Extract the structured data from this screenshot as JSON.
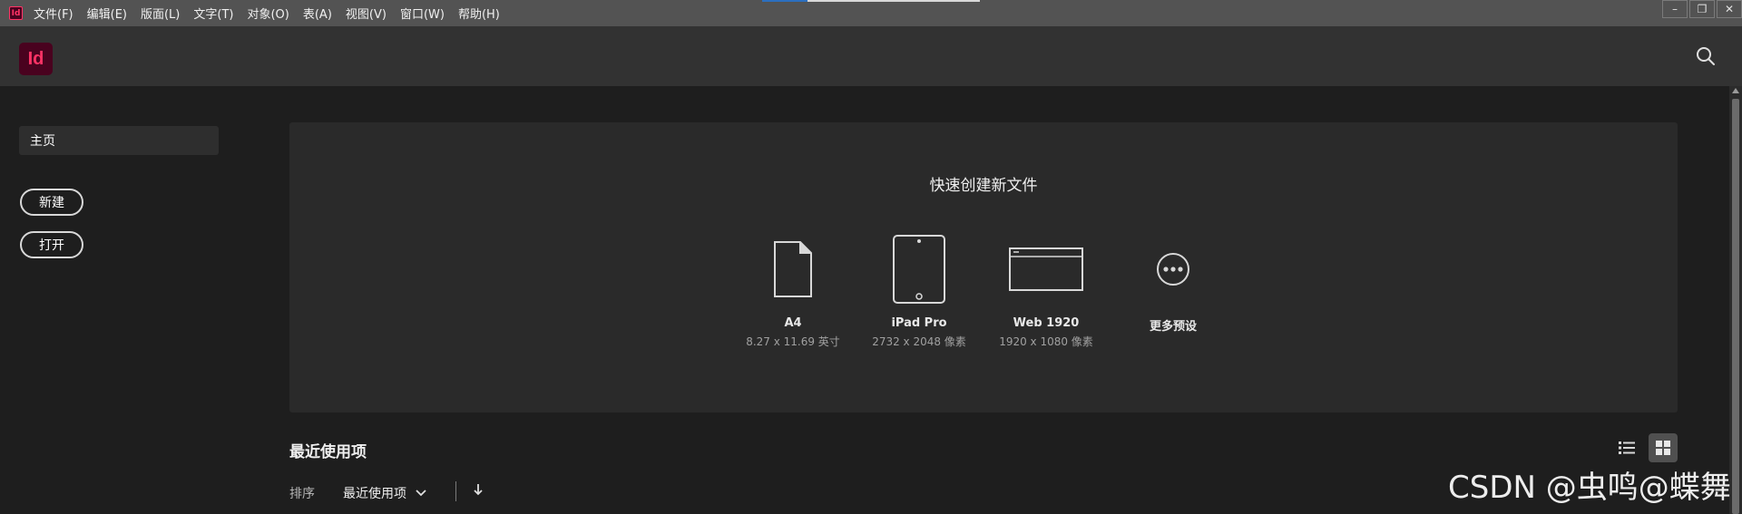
{
  "menubar": {
    "app_icon_text": "Id",
    "items": [
      "文件(F)",
      "编辑(E)",
      "版面(L)",
      "文字(T)",
      "对象(O)",
      "表(A)",
      "视图(V)",
      "窗口(W)",
      "帮助(H)"
    ],
    "window_controls": [
      "–",
      "❐",
      "✕"
    ]
  },
  "header": {
    "logo_text": "Id",
    "brand_color": "#ff3366",
    "search_icon": "search-icon"
  },
  "sidebar": {
    "home_label": "主页",
    "new_label": "新建",
    "open_label": "打开"
  },
  "quick_create": {
    "title": "快速创建新文件",
    "presets": [
      {
        "name": "A4",
        "dims": "8.27 x 11.69 英寸",
        "icon": "document-icon"
      },
      {
        "name": "iPad Pro",
        "dims": "2732 x 2048 像素",
        "icon": "tablet-icon"
      },
      {
        "name": "Web 1920",
        "dims": "1920 x 1080 像素",
        "icon": "browser-window-icon"
      },
      {
        "name": "更多预设",
        "dims": "",
        "icon": "more-icon"
      }
    ]
  },
  "recent": {
    "title": "最近使用项",
    "sort_label": "排序",
    "sort_value": "最近使用项",
    "view_modes": [
      "list-view-icon",
      "grid-view-icon"
    ],
    "active_view": "grid-view-icon"
  },
  "watermark": "CSDN @虫鸣@蝶舞"
}
